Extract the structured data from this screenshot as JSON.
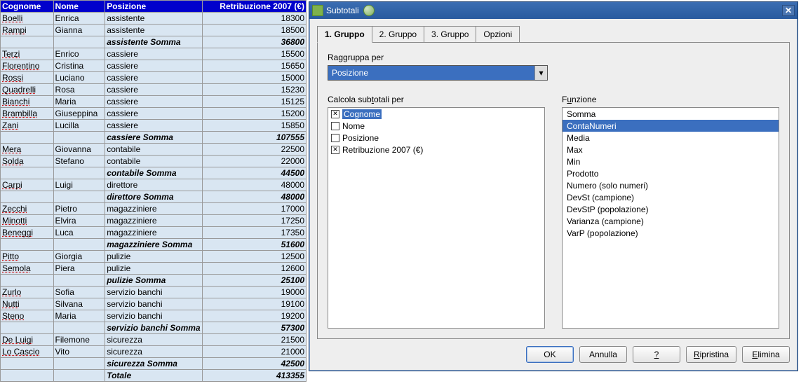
{
  "chart_data": {
    "type": "table",
    "note": "not a chart"
  },
  "table": {
    "headers": [
      "Cognome",
      "Nome",
      "Posizione",
      "Retribuzione 2007 (€)"
    ],
    "rows": [
      {
        "t": "d",
        "c": [
          "Boelli",
          "Enrica",
          "assistente",
          "18300"
        ]
      },
      {
        "t": "d",
        "c": [
          "Rampi",
          "Gianna",
          "assistente",
          "18500"
        ]
      },
      {
        "t": "s",
        "c": [
          "",
          "",
          "assistente Somma",
          "36800"
        ]
      },
      {
        "t": "d",
        "c": [
          "Terzi",
          "Enrico",
          "cassiere",
          "15500"
        ]
      },
      {
        "t": "d",
        "c": [
          "Florentino",
          "Cristina",
          "cassiere",
          "15650"
        ]
      },
      {
        "t": "d",
        "c": [
          "Rossi",
          "Luciano",
          "cassiere",
          "15000"
        ]
      },
      {
        "t": "d",
        "c": [
          "Quadrelli",
          "Rosa",
          "cassiere",
          "15230"
        ]
      },
      {
        "t": "d",
        "c": [
          "Bianchi",
          "Maria",
          "cassiere",
          "15125"
        ]
      },
      {
        "t": "d",
        "c": [
          "Brambilla",
          "Giuseppina",
          "cassiere",
          "15200"
        ]
      },
      {
        "t": "d",
        "c": [
          "Zani",
          "Lucilla",
          "cassiere",
          "15850"
        ]
      },
      {
        "t": "s",
        "c": [
          "",
          "",
          "cassiere Somma",
          "107555"
        ]
      },
      {
        "t": "d",
        "c": [
          "Mera",
          "Giovanna",
          "contabile",
          "22500"
        ]
      },
      {
        "t": "d",
        "c": [
          "Solda",
          "Stefano",
          "contabile",
          "22000"
        ]
      },
      {
        "t": "s",
        "c": [
          "",
          "",
          "contabile Somma",
          "44500"
        ]
      },
      {
        "t": "d",
        "c": [
          "Carpi",
          "Luigi",
          "direttore",
          "48000"
        ]
      },
      {
        "t": "s",
        "c": [
          "",
          "",
          "direttore Somma",
          "48000"
        ]
      },
      {
        "t": "d",
        "c": [
          "Zecchi",
          "Pietro",
          "magazziniere",
          "17000"
        ]
      },
      {
        "t": "d",
        "c": [
          "Minotti",
          "Elvira",
          "magazziniere",
          "17250"
        ]
      },
      {
        "t": "d",
        "c": [
          "Beneggi",
          "Luca",
          "magazziniere",
          "17350"
        ]
      },
      {
        "t": "s",
        "c": [
          "",
          "",
          "magazziniere Somma",
          "51600"
        ]
      },
      {
        "t": "d",
        "c": [
          "Pitto",
          "Giorgia",
          "pulizie",
          "12500"
        ]
      },
      {
        "t": "d",
        "c": [
          "Semola",
          "Piera",
          "pulizie",
          "12600"
        ]
      },
      {
        "t": "s",
        "c": [
          "",
          "",
          "pulizie Somma",
          "25100"
        ]
      },
      {
        "t": "d",
        "c": [
          "Zurlo",
          "Sofia",
          "servizio banchi",
          "19000"
        ]
      },
      {
        "t": "d",
        "c": [
          "Nutti",
          "Silvana",
          "servizio banchi",
          "19100"
        ]
      },
      {
        "t": "d",
        "c": [
          "Steno",
          "Maria",
          "servizio banchi",
          "19200"
        ]
      },
      {
        "t": "s",
        "c": [
          "",
          "",
          "servizio banchi Somma",
          "57300"
        ]
      },
      {
        "t": "d",
        "c": [
          "De Luigi",
          "Filemone",
          "sicurezza",
          "21500"
        ]
      },
      {
        "t": "d",
        "c": [
          "Lo Cascio",
          "Vito",
          "sicurezza",
          "21000"
        ]
      },
      {
        "t": "s",
        "c": [
          "",
          "",
          "sicurezza Somma",
          "42500"
        ]
      },
      {
        "t": "g",
        "c": [
          "",
          "",
          "Totale",
          "413355"
        ]
      }
    ]
  },
  "dialog": {
    "title": "Subtotali",
    "tabs": [
      "1. Gruppo",
      "2. Gruppo",
      "3. Gruppo",
      "Opzioni"
    ],
    "groupby_label_pre": "Ra",
    "groupby_label_accel": "g",
    "groupby_label_post": "gruppa per",
    "groupby_value": "Posizione",
    "calc_label_pre": "Calcola sub",
    "calc_label_accel": "t",
    "calc_label_post": "otali per",
    "func_label_pre": "F",
    "func_label_accel": "u",
    "func_label_post": "nzione",
    "columns": [
      {
        "label": "Cognome",
        "checked": true,
        "selected": true
      },
      {
        "label": "Nome",
        "checked": false,
        "selected": false
      },
      {
        "label": "Posizione",
        "checked": false,
        "selected": false
      },
      {
        "label": "Retribuzione 2007 (€)",
        "checked": true,
        "selected": false
      }
    ],
    "functions": [
      {
        "label": "Somma",
        "selected": false
      },
      {
        "label": "ContaNumeri",
        "selected": true
      },
      {
        "label": "Media",
        "selected": false
      },
      {
        "label": "Max",
        "selected": false
      },
      {
        "label": "Min",
        "selected": false
      },
      {
        "label": "Prodotto",
        "selected": false
      },
      {
        "label": "Numero (solo numeri)",
        "selected": false
      },
      {
        "label": "DevSt (campione)",
        "selected": false
      },
      {
        "label": "DevStP (popolazione)",
        "selected": false
      },
      {
        "label": "Varianza (campione)",
        "selected": false
      },
      {
        "label": "VarP (popolazione)",
        "selected": false
      }
    ],
    "buttons": {
      "ok": "OK",
      "cancel": "Annulla",
      "help": "?",
      "reset_pre": "",
      "reset_accel": "R",
      "reset_post": "ipristina",
      "delete_pre": "",
      "delete_accel": "E",
      "delete_post": "limina"
    }
  }
}
